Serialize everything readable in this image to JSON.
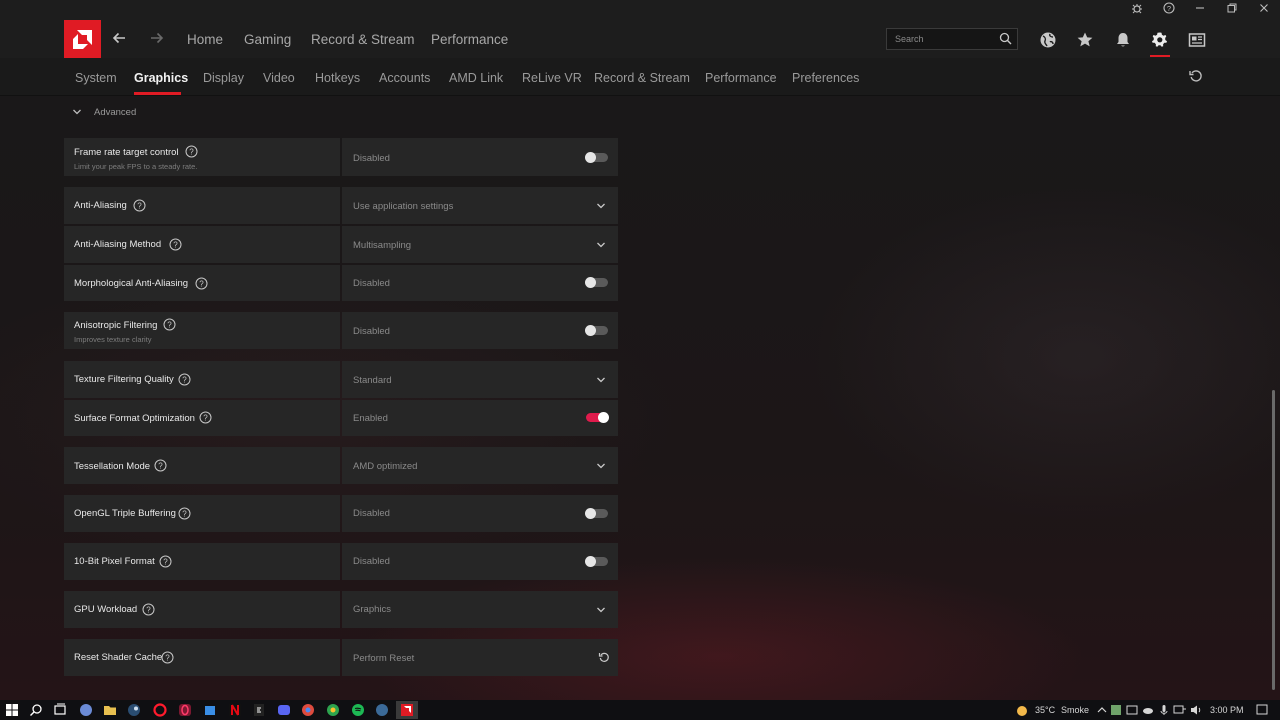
{
  "window": {
    "controls": [
      "bug-icon",
      "help-icon",
      "minimize-icon",
      "restore-icon",
      "close-icon"
    ]
  },
  "topnav": {
    "links": [
      "Home",
      "Gaming",
      "Record & Stream",
      "Performance"
    ],
    "search_placeholder": "Search",
    "icons": [
      "globe-icon",
      "star-icon",
      "bell-icon",
      "gear-icon",
      "news-icon"
    ]
  },
  "subnav": {
    "tabs": [
      "System",
      "Graphics",
      "Display",
      "Video",
      "Hotkeys",
      "Accounts",
      "AMD Link",
      "ReLive VR",
      "Record & Stream",
      "Performance",
      "Preferences"
    ],
    "active": "Graphics"
  },
  "section": {
    "title": "Advanced"
  },
  "settings": [
    {
      "label": "Frame rate target control",
      "subtitle": "Limit your peak FPS to a steady rate.",
      "value": "Disabled",
      "control": "toggle",
      "state": "off"
    },
    {
      "label": "Anti-Aliasing",
      "value": "Use application settings",
      "control": "dropdown"
    },
    {
      "label": "Anti-Aliasing Method",
      "value": "Multisampling",
      "control": "dropdown"
    },
    {
      "label": "Morphological Anti-Aliasing",
      "value": "Disabled",
      "control": "toggle",
      "state": "off"
    },
    {
      "label": "Anisotropic Filtering",
      "subtitle": "Improves texture clarity",
      "value": "Disabled",
      "control": "toggle",
      "state": "off"
    },
    {
      "label": "Texture Filtering Quality",
      "value": "Standard",
      "control": "dropdown"
    },
    {
      "label": "Surface Format Optimization",
      "value": "Enabled",
      "control": "toggle",
      "state": "on"
    },
    {
      "label": "Tessellation Mode",
      "value": "AMD optimized",
      "control": "dropdown"
    },
    {
      "label": "OpenGL Triple Buffering",
      "value": "Disabled",
      "control": "toggle",
      "state": "off"
    },
    {
      "label": "10-Bit Pixel Format",
      "value": "Disabled",
      "control": "toggle",
      "state": "off"
    },
    {
      "label": "GPU Workload",
      "value": "Graphics",
      "control": "dropdown"
    },
    {
      "label": "Reset Shader Cache",
      "value": "Perform Reset",
      "control": "reset"
    }
  ],
  "taskbar": {
    "weather": "35°C",
    "weather_desc": "Smoke",
    "time": "3:00 PM"
  },
  "colors": {
    "accent": "#e01b24",
    "toggle_on": "#e01b4c",
    "row_bg": "#262626"
  }
}
